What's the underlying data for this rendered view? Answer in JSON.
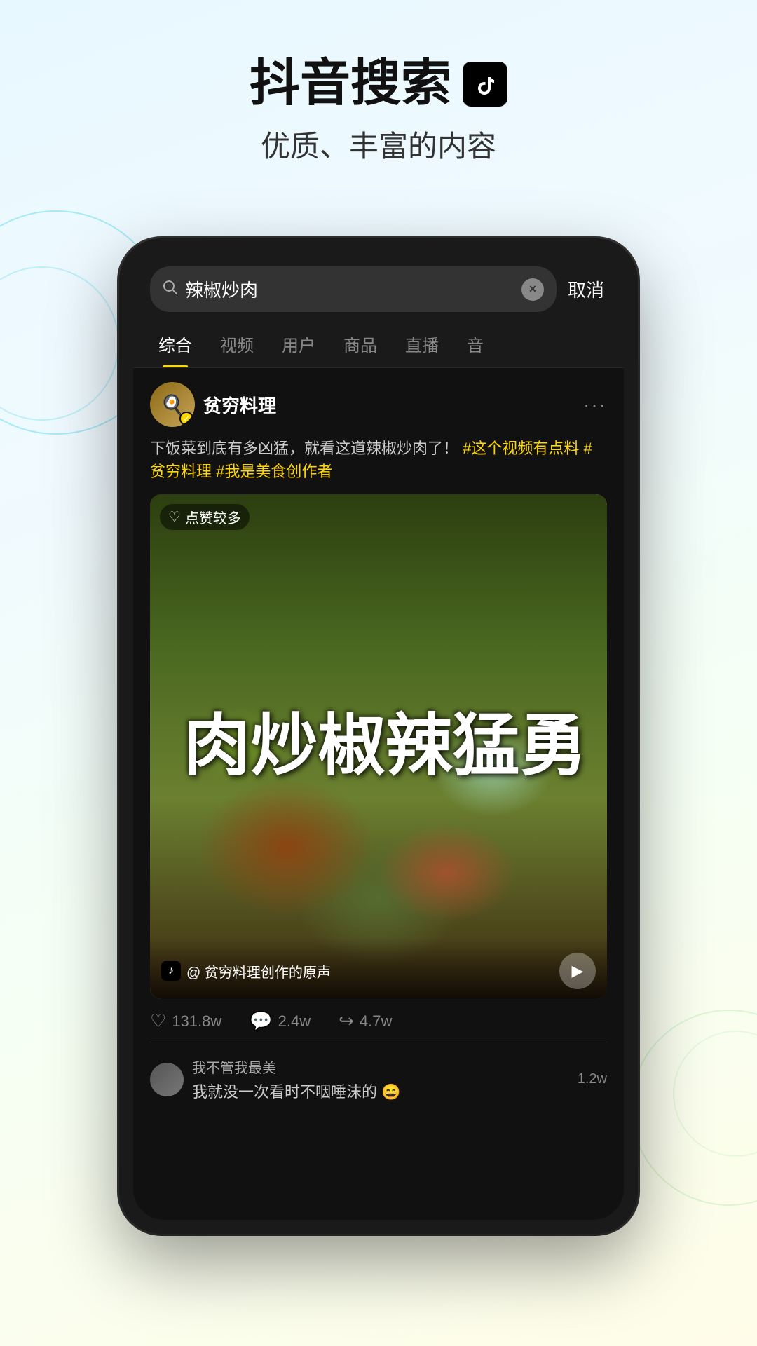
{
  "header": {
    "title": "抖音搜索",
    "subtitle": "优质、丰富的内容",
    "tiktok_logo": "♪"
  },
  "phone": {
    "search_bar": {
      "query": "辣椒炒肉",
      "cancel_label": "取消",
      "clear_icon": "×"
    },
    "tabs": [
      {
        "label": "综合",
        "active": true
      },
      {
        "label": "视频",
        "active": false
      },
      {
        "label": "用户",
        "active": false
      },
      {
        "label": "商品",
        "active": false
      },
      {
        "label": "直播",
        "active": false
      },
      {
        "label": "音",
        "active": false
      }
    ],
    "post": {
      "username": "贫穷料理",
      "verified": true,
      "description": "下饭菜到底有多凶猛，就看这道辣椒炒肉了！",
      "hashtags": [
        "#这个视频有点料",
        "#贫穷料理",
        "#我是美食创作者"
      ],
      "video_badge": "点赞较多",
      "video_title": "勇猛辣椒炒肉",
      "audio_text": "@ 贫穷料理创作的原声",
      "stats": {
        "likes": "131.8w",
        "comments": "2.4w",
        "shares": "4.7w"
      },
      "comments": [
        {
          "user": "我不管我最美",
          "text": "我就没一次看时不咽唾沫的 😄"
        },
        {
          "count": "1.2w"
        }
      ]
    }
  }
}
